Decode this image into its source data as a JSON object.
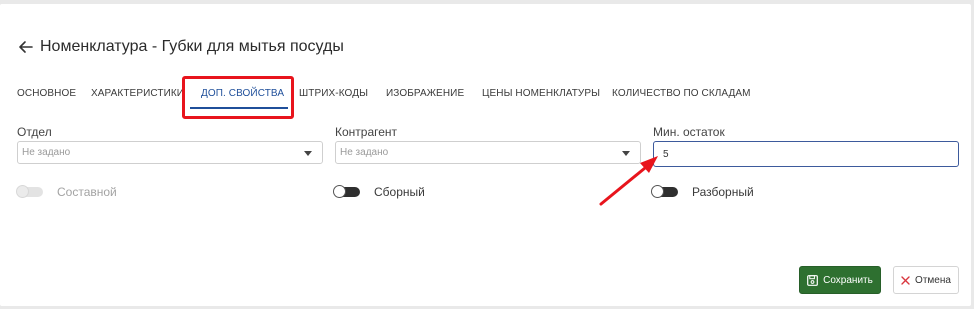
{
  "header": {
    "title": "Номенклатура - Губки для мытья посуды",
    "back_icon": "arrow-left-icon"
  },
  "tabs": [
    {
      "label": "ОСНОВНОЕ",
      "active": false
    },
    {
      "label": "ХАРАКТЕРИСТИКИ",
      "active": false
    },
    {
      "label": "ДОП. СВОЙСТВА",
      "active": true
    },
    {
      "label": "ШТРИХ-КОДЫ",
      "active": false
    },
    {
      "label": "ИЗОБРАЖЕНИЕ",
      "active": false
    },
    {
      "label": "ЦЕНЫ НОМЕНКЛАТУРЫ",
      "active": false
    },
    {
      "label": "КОЛИЧЕСТВО ПО СКЛАДАМ",
      "active": false
    }
  ],
  "fields": {
    "department": {
      "label": "Отдел",
      "placeholder": "Не задано"
    },
    "counterparty": {
      "label": "Контрагент",
      "placeholder": "Не задано"
    },
    "min_stock": {
      "label": "Мин. остаток",
      "value": "5"
    }
  },
  "toggles": [
    {
      "label": "Составной",
      "enabled": false,
      "on": false
    },
    {
      "label": "Сборный",
      "enabled": true,
      "on": false
    },
    {
      "label": "Разборный",
      "enabled": true,
      "on": false
    }
  ],
  "actions": {
    "save_label": "Сохранить",
    "save_icon": "floppy-disk-icon",
    "cancel_label": "Отмена",
    "cancel_icon": "close-icon"
  },
  "colors": {
    "accent": "#1f4f9a",
    "save_button": "#2e7030",
    "annotation": "#e8141c",
    "cancel_icon": "#d9363e"
  }
}
